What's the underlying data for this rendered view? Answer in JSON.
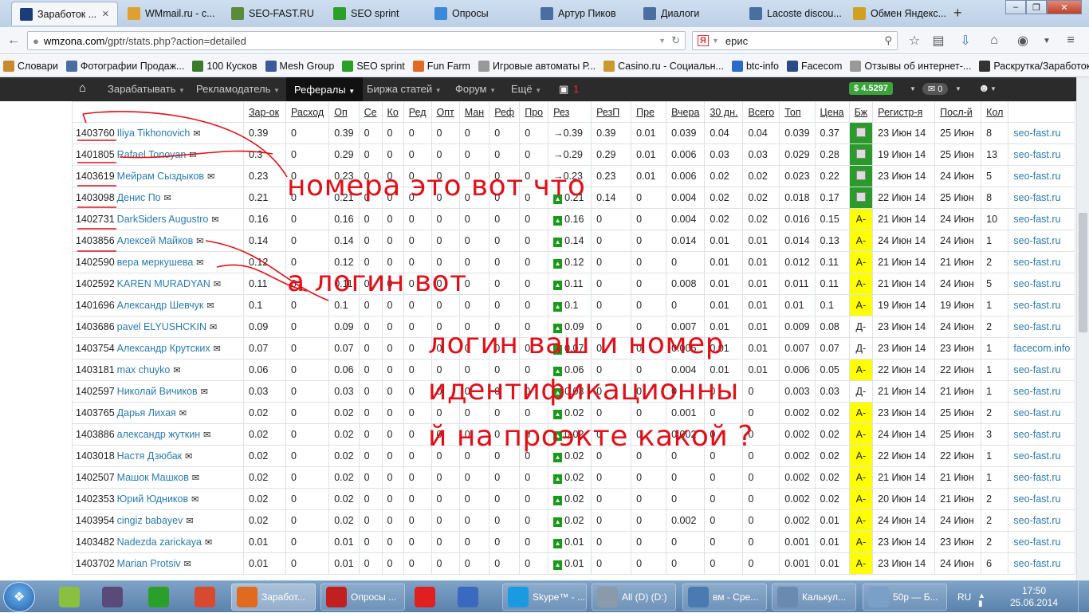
{
  "browser": {
    "tabs": [
      {
        "label": "Заработок ...",
        "icon": "wmzona-icon",
        "color": "#1a3d7a",
        "active": true
      },
      {
        "label": "WMmail.ru - с...",
        "icon": "wmmail-icon",
        "color": "#e0a030"
      },
      {
        "label": "SEO-FAST.RU",
        "icon": "seofast-icon",
        "color": "#5a8a3a"
      },
      {
        "label": "SEO sprint",
        "icon": "seosprint-icon",
        "color": "#2aa02a"
      },
      {
        "label": "Опросы",
        "icon": "heart-icon",
        "color": "#3a8ad8"
      },
      {
        "label": "Артур Пиков",
        "icon": "vk-icon",
        "color": "#4a6ea0"
      },
      {
        "label": "Диалоги",
        "icon": "vk-icon",
        "color": "#4a6ea0"
      },
      {
        "label": "Lacoste discou...",
        "icon": "vk-icon",
        "color": "#4a6ea0"
      },
      {
        "label": "Обмен Яндекс...",
        "icon": "exchange-icon",
        "color": "#d0a020"
      }
    ],
    "new_tab": "+",
    "url_host": "wmzona.com",
    "url_path": "/gptr/stats.php?action=detailed",
    "search_value": "ерис",
    "bookmarks": [
      {
        "label": "Словари",
        "icon": "dictionary-icon",
        "color": "#c88a30"
      },
      {
        "label": "Фотографии Продаж...",
        "icon": "vk-icon",
        "color": "#4a6ea0"
      },
      {
        "label": "100 Кусков",
        "icon": "bars-icon",
        "color": "#3a7a2a"
      },
      {
        "label": "Mesh Group",
        "icon": "facebook-icon",
        "color": "#3b5998"
      },
      {
        "label": "SEO sprint",
        "icon": "seosprint-icon",
        "color": "#2aa02a"
      },
      {
        "label": "Fun Farm",
        "icon": "farm-icon",
        "color": "#e06a20"
      },
      {
        "label": "Игровые автоматы Р...",
        "icon": "page-icon",
        "color": "#999999"
      },
      {
        "label": "Casino.ru - Социальн...",
        "icon": "casino-icon",
        "color": "#c89a30"
      },
      {
        "label": "btc-info",
        "icon": "btc-icon",
        "color": "#2a6ac8"
      },
      {
        "label": "Facecom",
        "icon": "facecom-icon",
        "color": "#2a4a8a"
      },
      {
        "label": "Отзывы об интернет-...",
        "icon": "page-icon",
        "color": "#999999"
      },
      {
        "label": "Раскрутка/Заработок...",
        "icon": "chrome-icon",
        "color": "#333333"
      }
    ]
  },
  "site_nav": {
    "items": [
      "Зарабатывать",
      "Рекламодатель",
      "Рефералы",
      "Биржа статей",
      "Форум",
      "Ещё"
    ],
    "active": "Рефералы",
    "notify_count": "1",
    "balance": "$ 4.5297",
    "messages": "0"
  },
  "table": {
    "headers": [
      "",
      "Зар-ок",
      "Расход",
      "Оп",
      "Се",
      "Ко",
      "Ред",
      "Опт",
      "Ман",
      "Реф",
      "Про",
      "Рез",
      "РезП",
      "Пре",
      "Вчера",
      "30 дн.",
      "Всего",
      "Топ",
      "Цена",
      "Бж",
      "Регистр-я",
      "Посл-й",
      "Кол",
      ""
    ],
    "rows": [
      {
        "id": "1403760",
        "login": "Iliya Tikhonovich",
        "zar": "0.39",
        "ras": "0",
        "op": "0.39",
        "se": "0",
        "ko": "0",
        "red": "0",
        "opt": "0",
        "man": "0",
        "ref": "0",
        "pro": "0",
        "rez": "→0.39",
        "rezp": "0.39",
        "pre": "0.01",
        "vch": "0.039",
        "d30": "0.04",
        "vse": "0.04",
        "top": "0.039",
        "cena": "0.37",
        "bz": "",
        "bzc": "green",
        "reg": "23 Июн 14",
        "last": "25 Июн",
        "kol": "8",
        "src": "seo-fast.ru"
      },
      {
        "id": "1401805",
        "login": "Rafael Tonoyan",
        "zar": "0.3",
        "ras": "0",
        "op": "0.29",
        "se": "0",
        "ko": "0",
        "red": "0",
        "opt": "0",
        "man": "0",
        "ref": "0",
        "pro": "0",
        "rez": "→0.29",
        "rezp": "0.29",
        "pre": "0.01",
        "vch": "0.006",
        "d30": "0.03",
        "vse": "0.03",
        "top": "0.029",
        "cena": "0.28",
        "bz": "",
        "bzc": "green",
        "reg": "19 Июн 14",
        "last": "25 Июн",
        "kol": "13",
        "src": "seo-fast.ru"
      },
      {
        "id": "1403619",
        "login": "Мейрам Сыздыков",
        "zar": "0.23",
        "ras": "0",
        "op": "0.23",
        "se": "0",
        "ko": "0",
        "red": "0",
        "opt": "0",
        "man": "0",
        "ref": "0",
        "pro": "0",
        "rez": "→0.23",
        "rezp": "0.23",
        "pre": "0.01",
        "vch": "0.006",
        "d30": "0.02",
        "vse": "0.02",
        "top": "0.023",
        "cena": "0.22",
        "bz": "",
        "bzc": "green",
        "reg": "23 Июн 14",
        "last": "24 Июн",
        "kol": "5",
        "src": "seo-fast.ru"
      },
      {
        "id": "1403098",
        "login": "Денис По",
        "zar": "0.21",
        "ras": "0",
        "op": "0.21",
        "se": "0",
        "ko": "0",
        "red": "0",
        "opt": "0",
        "man": "0",
        "ref": "0",
        "pro": "0",
        "rez": "0.21",
        "rezp": "0.14",
        "pre": "0",
        "vch": "0.004",
        "d30": "0.02",
        "vse": "0.02",
        "top": "0.018",
        "cena": "0.17",
        "bz": "",
        "bzc": "green",
        "reg": "22 Июн 14",
        "last": "25 Июн",
        "kol": "8",
        "src": "seo-fast.ru"
      },
      {
        "id": "1402731",
        "login": "DarkSiders Augustro",
        "zar": "0.16",
        "ras": "0",
        "op": "0.16",
        "se": "0",
        "ko": "0",
        "red": "0",
        "opt": "0",
        "man": "0",
        "ref": "0",
        "pro": "0",
        "rez": "0.16",
        "rezp": "0",
        "pre": "0",
        "vch": "0.004",
        "d30": "0.02",
        "vse": "0.02",
        "top": "0.016",
        "cena": "0.15",
        "bz": "A-",
        "bzc": "yellow",
        "reg": "21 Июн 14",
        "last": "24 Июн",
        "kol": "10",
        "src": "seo-fast.ru"
      },
      {
        "id": "1403856",
        "login": "Алексей Майков",
        "zar": "0.14",
        "ras": "0",
        "op": "0.14",
        "se": "0",
        "ko": "0",
        "red": "0",
        "opt": "0",
        "man": "0",
        "ref": "0",
        "pro": "0",
        "rez": "0.14",
        "rezp": "0",
        "pre": "0",
        "vch": "0.014",
        "d30": "0.01",
        "vse": "0.01",
        "top": "0.014",
        "cena": "0.13",
        "bz": "A-",
        "bzc": "yellow",
        "reg": "24 Июн 14",
        "last": "24 Июн",
        "kol": "1",
        "src": "seo-fast.ru"
      },
      {
        "id": "1402590",
        "login": "вера меркушева",
        "zar": "0.12",
        "ras": "0",
        "op": "0.12",
        "se": "0",
        "ko": "0",
        "red": "0",
        "opt": "0",
        "man": "0",
        "ref": "0",
        "pro": "0",
        "rez": "0.12",
        "rezp": "0",
        "pre": "0",
        "vch": "0",
        "d30": "0.01",
        "vse": "0.01",
        "top": "0.012",
        "cena": "0.11",
        "bz": "A-",
        "bzc": "yellow",
        "reg": "21 Июн 14",
        "last": "21 Июн",
        "kol": "2",
        "src": "seo-fast.ru"
      },
      {
        "id": "1402592",
        "login": "KAREN MURADYAN",
        "zar": "0.11",
        "ras": "0",
        "op": "0.11",
        "se": "0",
        "ko": "0",
        "red": "0",
        "opt": "0",
        "man": "0",
        "ref": "0",
        "pro": "0",
        "rez": "0.11",
        "rezp": "0",
        "pre": "0",
        "vch": "0.008",
        "d30": "0.01",
        "vse": "0.01",
        "top": "0.011",
        "cena": "0.11",
        "bz": "A-",
        "bzc": "yellow",
        "reg": "21 Июн 14",
        "last": "24 Июн",
        "kol": "5",
        "src": "seo-fast.ru"
      },
      {
        "id": "1401696",
        "login": "Александр Шевчук",
        "zar": "0.1",
        "ras": "0",
        "op": "0.1",
        "se": "0",
        "ko": "0",
        "red": "0",
        "opt": "0",
        "man": "0",
        "ref": "0",
        "pro": "0",
        "rez": "0.1",
        "rezp": "0",
        "pre": "0",
        "vch": "0",
        "d30": "0.01",
        "vse": "0.01",
        "top": "0.01",
        "cena": "0.1",
        "bz": "A-",
        "bzc": "yellow",
        "reg": "19 Июн 14",
        "last": "19 Июн",
        "kol": "1",
        "src": "seo-fast.ru"
      },
      {
        "id": "1403686",
        "login": "pavel ELYUSHCKIN",
        "zar": "0.09",
        "ras": "0",
        "op": "0.09",
        "se": "0",
        "ko": "0",
        "red": "0",
        "opt": "0",
        "man": "0",
        "ref": "0",
        "pro": "0",
        "rez": "0.09",
        "rezp": "0",
        "pre": "0",
        "vch": "0.007",
        "d30": "0.01",
        "vse": "0.01",
        "top": "0.009",
        "cena": "0.08",
        "bz": "Д-",
        "bzc": "none",
        "reg": "23 Июн 14",
        "last": "24 Июн",
        "kol": "2",
        "src": "seo-fast.ru"
      },
      {
        "id": "1403754",
        "login": "Александр Крутских",
        "zar": "0.07",
        "ras": "0",
        "op": "0.07",
        "se": "0",
        "ko": "0",
        "red": "0",
        "opt": "0",
        "man": "0",
        "ref": "0",
        "pro": "0",
        "rez": "0.07",
        "rezp": "0",
        "pre": "0",
        "vch": "0.005",
        "d30": "0.01",
        "vse": "0.01",
        "top": "0.007",
        "cena": "0.07",
        "bz": "Д-",
        "bzc": "none",
        "reg": "23 Июн 14",
        "last": "23 Июн",
        "kol": "1",
        "src": "facecom.info"
      },
      {
        "id": "1403181",
        "login": "max chuyko",
        "zar": "0.06",
        "ras": "0",
        "op": "0.06",
        "se": "0",
        "ko": "0",
        "red": "0",
        "opt": "0",
        "man": "0",
        "ref": "0",
        "pro": "0",
        "rez": "0.06",
        "rezp": "0",
        "pre": "0",
        "vch": "0.004",
        "d30": "0.01",
        "vse": "0.01",
        "top": "0.006",
        "cena": "0.05",
        "bz": "A-",
        "bzc": "yellow",
        "reg": "22 Июн 14",
        "last": "22 Июн",
        "kol": "1",
        "src": "seo-fast.ru"
      },
      {
        "id": "1402597",
        "login": "Николай Вичиков",
        "zar": "0.03",
        "ras": "0",
        "op": "0.03",
        "se": "0",
        "ko": "0",
        "red": "0",
        "opt": "0",
        "man": "0",
        "ref": "0",
        "pro": "0",
        "rez": "0.03",
        "rezp": "0",
        "pre": "0",
        "vch": "0",
        "d30": "0",
        "vse": "0",
        "top": "0.003",
        "cena": "0.03",
        "bz": "Д-",
        "bzc": "none",
        "reg": "21 Июн 14",
        "last": "21 Июн",
        "kol": "1",
        "src": "seo-fast.ru"
      },
      {
        "id": "1403765",
        "login": "Дарья Лихая",
        "zar": "0.02",
        "ras": "0",
        "op": "0.02",
        "se": "0",
        "ko": "0",
        "red": "0",
        "opt": "0",
        "man": "0",
        "ref": "0",
        "pro": "0",
        "rez": "0.02",
        "rezp": "0",
        "pre": "0",
        "vch": "0.001",
        "d30": "0",
        "vse": "0",
        "top": "0.002",
        "cena": "0.02",
        "bz": "A-",
        "bzc": "yellow",
        "reg": "23 Июн 14",
        "last": "25 Июн",
        "kol": "2",
        "src": "seo-fast.ru"
      },
      {
        "id": "1403886",
        "login": "александр жуткин",
        "zar": "0.02",
        "ras": "0",
        "op": "0.02",
        "se": "0",
        "ko": "0",
        "red": "0",
        "opt": "0",
        "man": "0",
        "ref": "0",
        "pro": "0",
        "rez": "0.02",
        "rezp": "0",
        "pre": "0",
        "vch": "0.002",
        "d30": "0",
        "vse": "0",
        "top": "0.002",
        "cena": "0.02",
        "bz": "A-",
        "bzc": "yellow",
        "reg": "24 Июн 14",
        "last": "25 Июн",
        "kol": "3",
        "src": "seo-fast.ru"
      },
      {
        "id": "1403018",
        "login": "Настя Дзюбак",
        "zar": "0.02",
        "ras": "0",
        "op": "0.02",
        "se": "0",
        "ko": "0",
        "red": "0",
        "opt": "0",
        "man": "0",
        "ref": "0",
        "pro": "0",
        "rez": "0.02",
        "rezp": "0",
        "pre": "0",
        "vch": "0",
        "d30": "0",
        "vse": "0",
        "top": "0.002",
        "cena": "0.02",
        "bz": "A-",
        "bzc": "yellow",
        "reg": "22 Июн 14",
        "last": "22 Июн",
        "kol": "1",
        "src": "seo-fast.ru"
      },
      {
        "id": "1402507",
        "login": "Машок Машков",
        "zar": "0.02",
        "ras": "0",
        "op": "0.02",
        "se": "0",
        "ko": "0",
        "red": "0",
        "opt": "0",
        "man": "0",
        "ref": "0",
        "pro": "0",
        "rez": "0.02",
        "rezp": "0",
        "pre": "0",
        "vch": "0",
        "d30": "0",
        "vse": "0",
        "top": "0.002",
        "cena": "0.02",
        "bz": "A-",
        "bzc": "yellow",
        "reg": "21 Июн 14",
        "last": "21 Июн",
        "kol": "1",
        "src": "seo-fast.ru"
      },
      {
        "id": "1402353",
        "login": "Юрий Юдников",
        "zar": "0.02",
        "ras": "0",
        "op": "0.02",
        "se": "0",
        "ko": "0",
        "red": "0",
        "opt": "0",
        "man": "0",
        "ref": "0",
        "pro": "0",
        "rez": "0.02",
        "rezp": "0",
        "pre": "0",
        "vch": "0",
        "d30": "0",
        "vse": "0",
        "top": "0.002",
        "cena": "0.02",
        "bz": "A-",
        "bzc": "yellow",
        "reg": "20 Июн 14",
        "last": "21 Июн",
        "kol": "2",
        "src": "seo-fast.ru"
      },
      {
        "id": "1403954",
        "login": "cingiz babayev",
        "zar": "0.02",
        "ras": "0",
        "op": "0.02",
        "se": "0",
        "ko": "0",
        "red": "0",
        "opt": "0",
        "man": "0",
        "ref": "0",
        "pro": "0",
        "rez": "0.02",
        "rezp": "0",
        "pre": "0",
        "vch": "0.002",
        "d30": "0",
        "vse": "0",
        "top": "0.002",
        "cena": "0.01",
        "bz": "A-",
        "bzc": "yellow",
        "reg": "24 Июн 14",
        "last": "24 Июн",
        "kol": "2",
        "src": "seo-fast.ru"
      },
      {
        "id": "1403482",
        "login": "Nadezda zarickaya",
        "zar": "0.01",
        "ras": "0",
        "op": "0.01",
        "se": "0",
        "ko": "0",
        "red": "0",
        "opt": "0",
        "man": "0",
        "ref": "0",
        "pro": "0",
        "rez": "0.01",
        "rezp": "0",
        "pre": "0",
        "vch": "0",
        "d30": "0",
        "vse": "0",
        "top": "0.001",
        "cena": "0.01",
        "bz": "A-",
        "bzc": "yellow",
        "reg": "23 Июн 14",
        "last": "23 Июн",
        "kol": "2",
        "src": "seo-fast.ru"
      },
      {
        "id": "1403702",
        "login": "Marian Protsiv",
        "zar": "0.01",
        "ras": "0",
        "op": "0.01",
        "se": "0",
        "ko": "0",
        "red": "0",
        "opt": "0",
        "man": "0",
        "ref": "0",
        "pro": "0",
        "rez": "0.01",
        "rezp": "0",
        "pre": "0",
        "vch": "0",
        "d30": "0",
        "vse": "0",
        "top": "0.001",
        "cena": "0.01",
        "bz": "A-",
        "bzc": "yellow",
        "reg": "23 Июн 14",
        "last": "24 Июн",
        "kol": "6",
        "src": "seo-fast.ru"
      }
    ]
  },
  "annotations": {
    "note1": "номера это вот что",
    "note2": "а логин вот",
    "note3a": "логин ваш и номер",
    "note3b": "идентификационны",
    "note3c": "й на проэкте какой ?"
  },
  "taskbar": {
    "items": [
      {
        "label": "",
        "icon": "bird-icon",
        "color": "#8ac040"
      },
      {
        "label": "",
        "icon": "game-icon",
        "color": "#5a4a7a"
      },
      {
        "label": "",
        "icon": "a-icon",
        "color": "#2aa02a"
      },
      {
        "label": "",
        "icon": "chrome-icon",
        "color": "#d84a30"
      },
      {
        "label": "Заработ...",
        "icon": "firefox-icon",
        "color": "#e06a20",
        "active": true
      },
      {
        "label": "Опросы ...",
        "icon": "opera-icon",
        "color": "#c02020"
      },
      {
        "label": "",
        "icon": "yandex-icon",
        "color": "#e02020"
      },
      {
        "label": "",
        "icon": "speaker-icon",
        "color": "#3a6ac0"
      },
      {
        "label": "Skype™ - ...",
        "icon": "skype-icon",
        "color": "#1a9ae0"
      },
      {
        "label": "All (D) (D:)",
        "icon": "drive-icon",
        "color": "#8a9aaa"
      },
      {
        "label": "вм - Сре...",
        "icon": "photo-icon",
        "color": "#4a7ab0"
      },
      {
        "label": "Калькул...",
        "icon": "calculator-icon",
        "color": "#6a8ab0"
      },
      {
        "label": "50р — Б...",
        "icon": "notepad-icon",
        "color": "#7aa0c8"
      }
    ],
    "lang": "RU",
    "time": "17:50",
    "date": "25.06.2014"
  }
}
